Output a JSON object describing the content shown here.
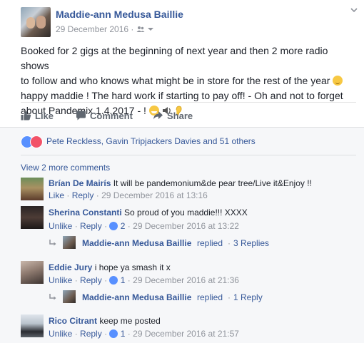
{
  "post": {
    "author": "Maddie-ann Medusa Baillie",
    "date": "29 December 2016",
    "audience_icon": "friends-icon",
    "text_line_1": "Booked for 2 gigs at the beginning of next year and then 2 more radio shows",
    "text_line_2": "to follow and who knows what might be in store for the rest of the year",
    "text_line_3": "happy maddie ! The hard work if starting to pay off! - Oh and not to forget",
    "text_line_4": "about Pandemix 1.4.2017 - !"
  },
  "actions": {
    "like": "Like",
    "comment": "Comment",
    "share": "Share"
  },
  "reactions": {
    "names": "Pete Reckless, Gavin Tripjackers Davies and 51 others"
  },
  "comments_section": {
    "view_more": "View 2 more comments",
    "comments": [
      {
        "author": "Brían De Mairís",
        "text": "It will be pandemonium&de pear tree/Live it&Enjoy !!",
        "action": "Like",
        "reply": "Reply",
        "timestamp": "29 December 2016 at 13:16"
      },
      {
        "author": "Sherina Constanti",
        "text": "So proud of you maddie!!! XXXX",
        "action": "Unlike",
        "reply": "Reply",
        "likes": "2",
        "timestamp": "29 December 2016 at 13:22",
        "replied_by": "Maddie-ann Medusa Baillie",
        "replied_text": "replied",
        "replies": "3 Replies"
      },
      {
        "author": "Eddie Jury",
        "text": "i hope ya smash it x",
        "action": "Unlike",
        "reply": "Reply",
        "likes": "1",
        "timestamp": "29 December 2016 at 21:36",
        "replied_by": "Maddie-ann Medusa Baillie",
        "replied_text": "replied",
        "replies": "1 Reply"
      },
      {
        "author": "Rico Citrant",
        "text": "keep me posted",
        "action": "Unlike",
        "reply": "Reply",
        "likes": "1",
        "timestamp": "29 December 2016 at 21:57"
      }
    ]
  },
  "separators": {
    "dot": "·"
  },
  "colors": {
    "link_blue": "#365899",
    "meta_gray": "#90949c",
    "text": "#1d2129",
    "like_blue": "#5890ff",
    "love_red": "#f25268"
  }
}
